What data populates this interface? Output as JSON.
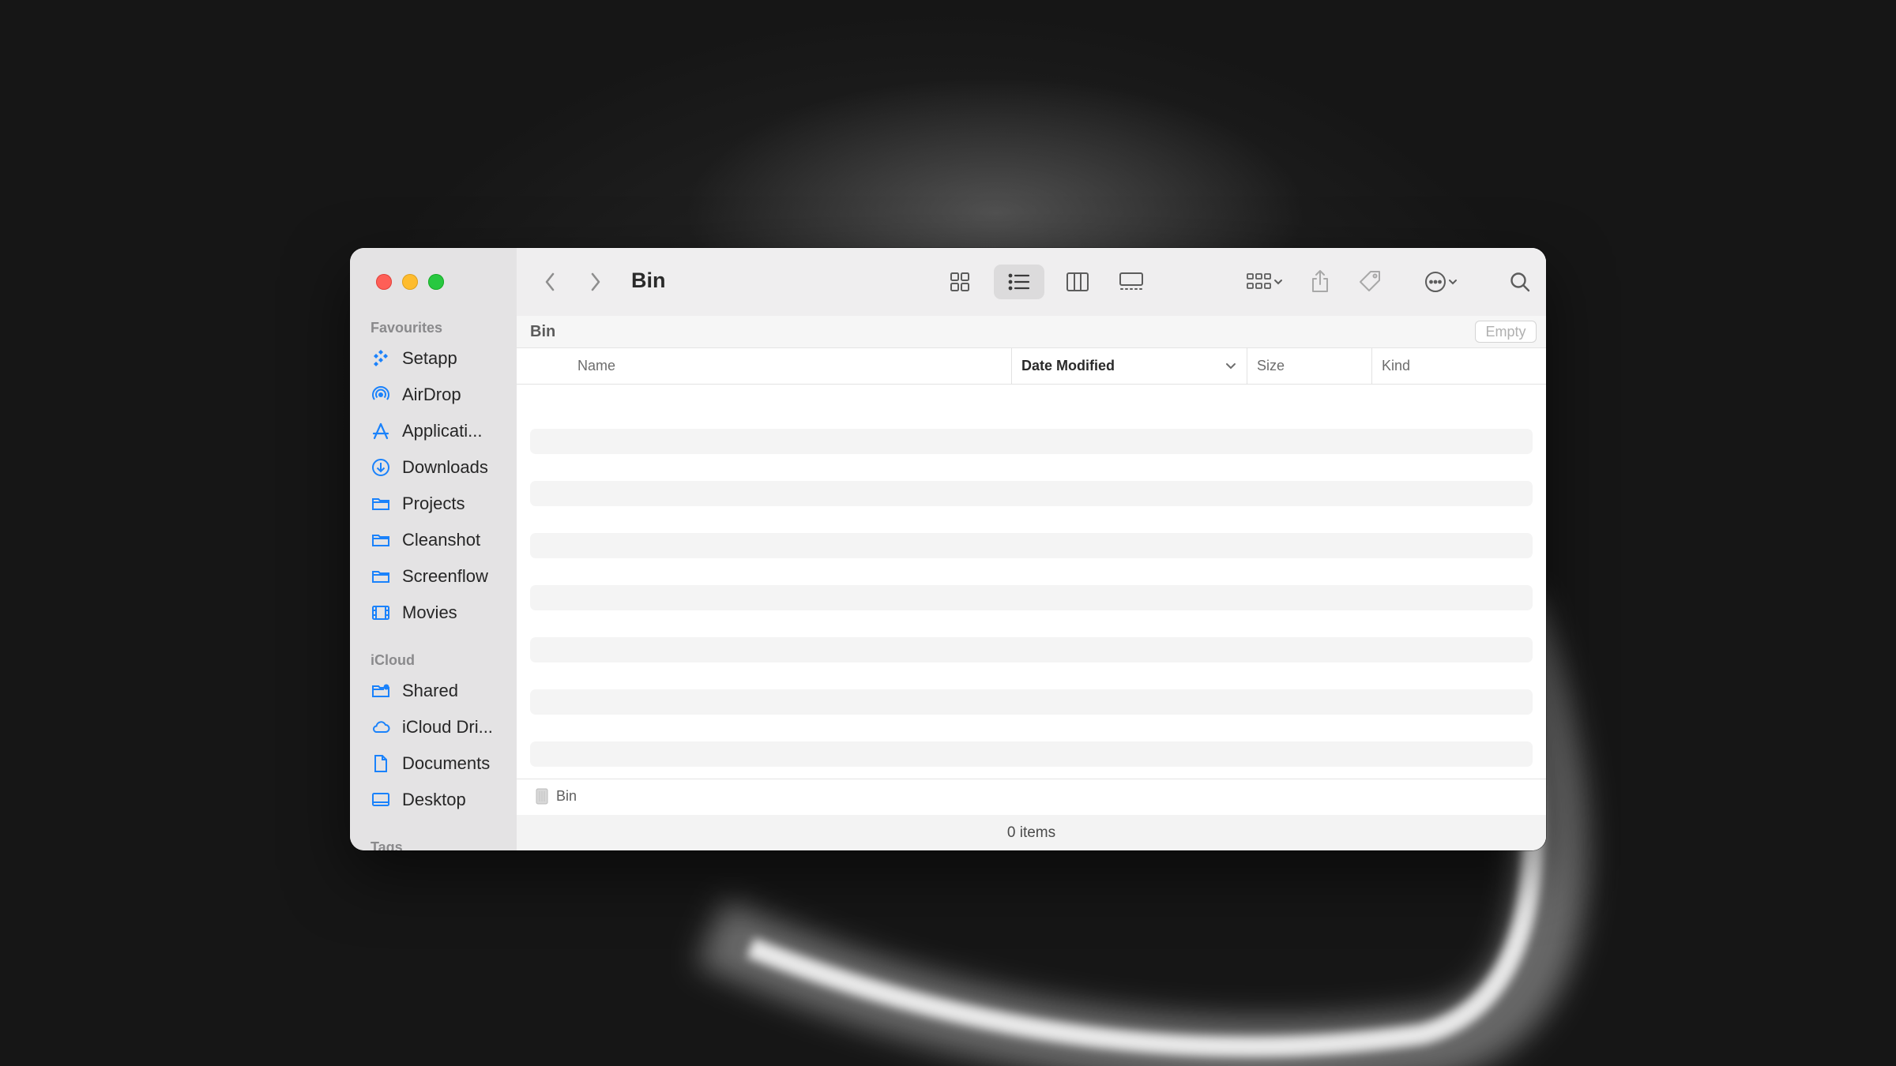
{
  "window": {
    "title": "Bin",
    "path_label": "Bin",
    "empty_button": "Empty"
  },
  "sidebar": {
    "sections": [
      {
        "title": "Favourites",
        "items": [
          {
            "label": "Setapp",
            "icon": "setapp-icon"
          },
          {
            "label": "AirDrop",
            "icon": "airdrop-icon"
          },
          {
            "label": "Applicati...",
            "icon": "applications-icon"
          },
          {
            "label": "Downloads",
            "icon": "downloads-icon"
          },
          {
            "label": "Projects",
            "icon": "folder-icon"
          },
          {
            "label": "Cleanshot",
            "icon": "folder-icon"
          },
          {
            "label": "Screenflow",
            "icon": "folder-icon"
          },
          {
            "label": "Movies",
            "icon": "movies-icon"
          }
        ]
      },
      {
        "title": "iCloud",
        "items": [
          {
            "label": "Shared",
            "icon": "shared-folder-icon"
          },
          {
            "label": "iCloud Dri...",
            "icon": "icloud-icon"
          },
          {
            "label": "Documents",
            "icon": "document-icon"
          },
          {
            "label": "Desktop",
            "icon": "desktop-icon"
          }
        ]
      },
      {
        "title": "Tags",
        "items": []
      }
    ]
  },
  "columns": [
    {
      "label": "Name"
    },
    {
      "label": "Date Modified",
      "sorted": true
    },
    {
      "label": "Size"
    },
    {
      "label": "Kind"
    }
  ],
  "pathbar": {
    "crumb": "Bin"
  },
  "status": {
    "items_count": "0 items"
  },
  "colors": {
    "accent": "#1a82fb",
    "close": "#fe5f57",
    "minimize": "#febc2e",
    "maximize": "#28c840"
  }
}
